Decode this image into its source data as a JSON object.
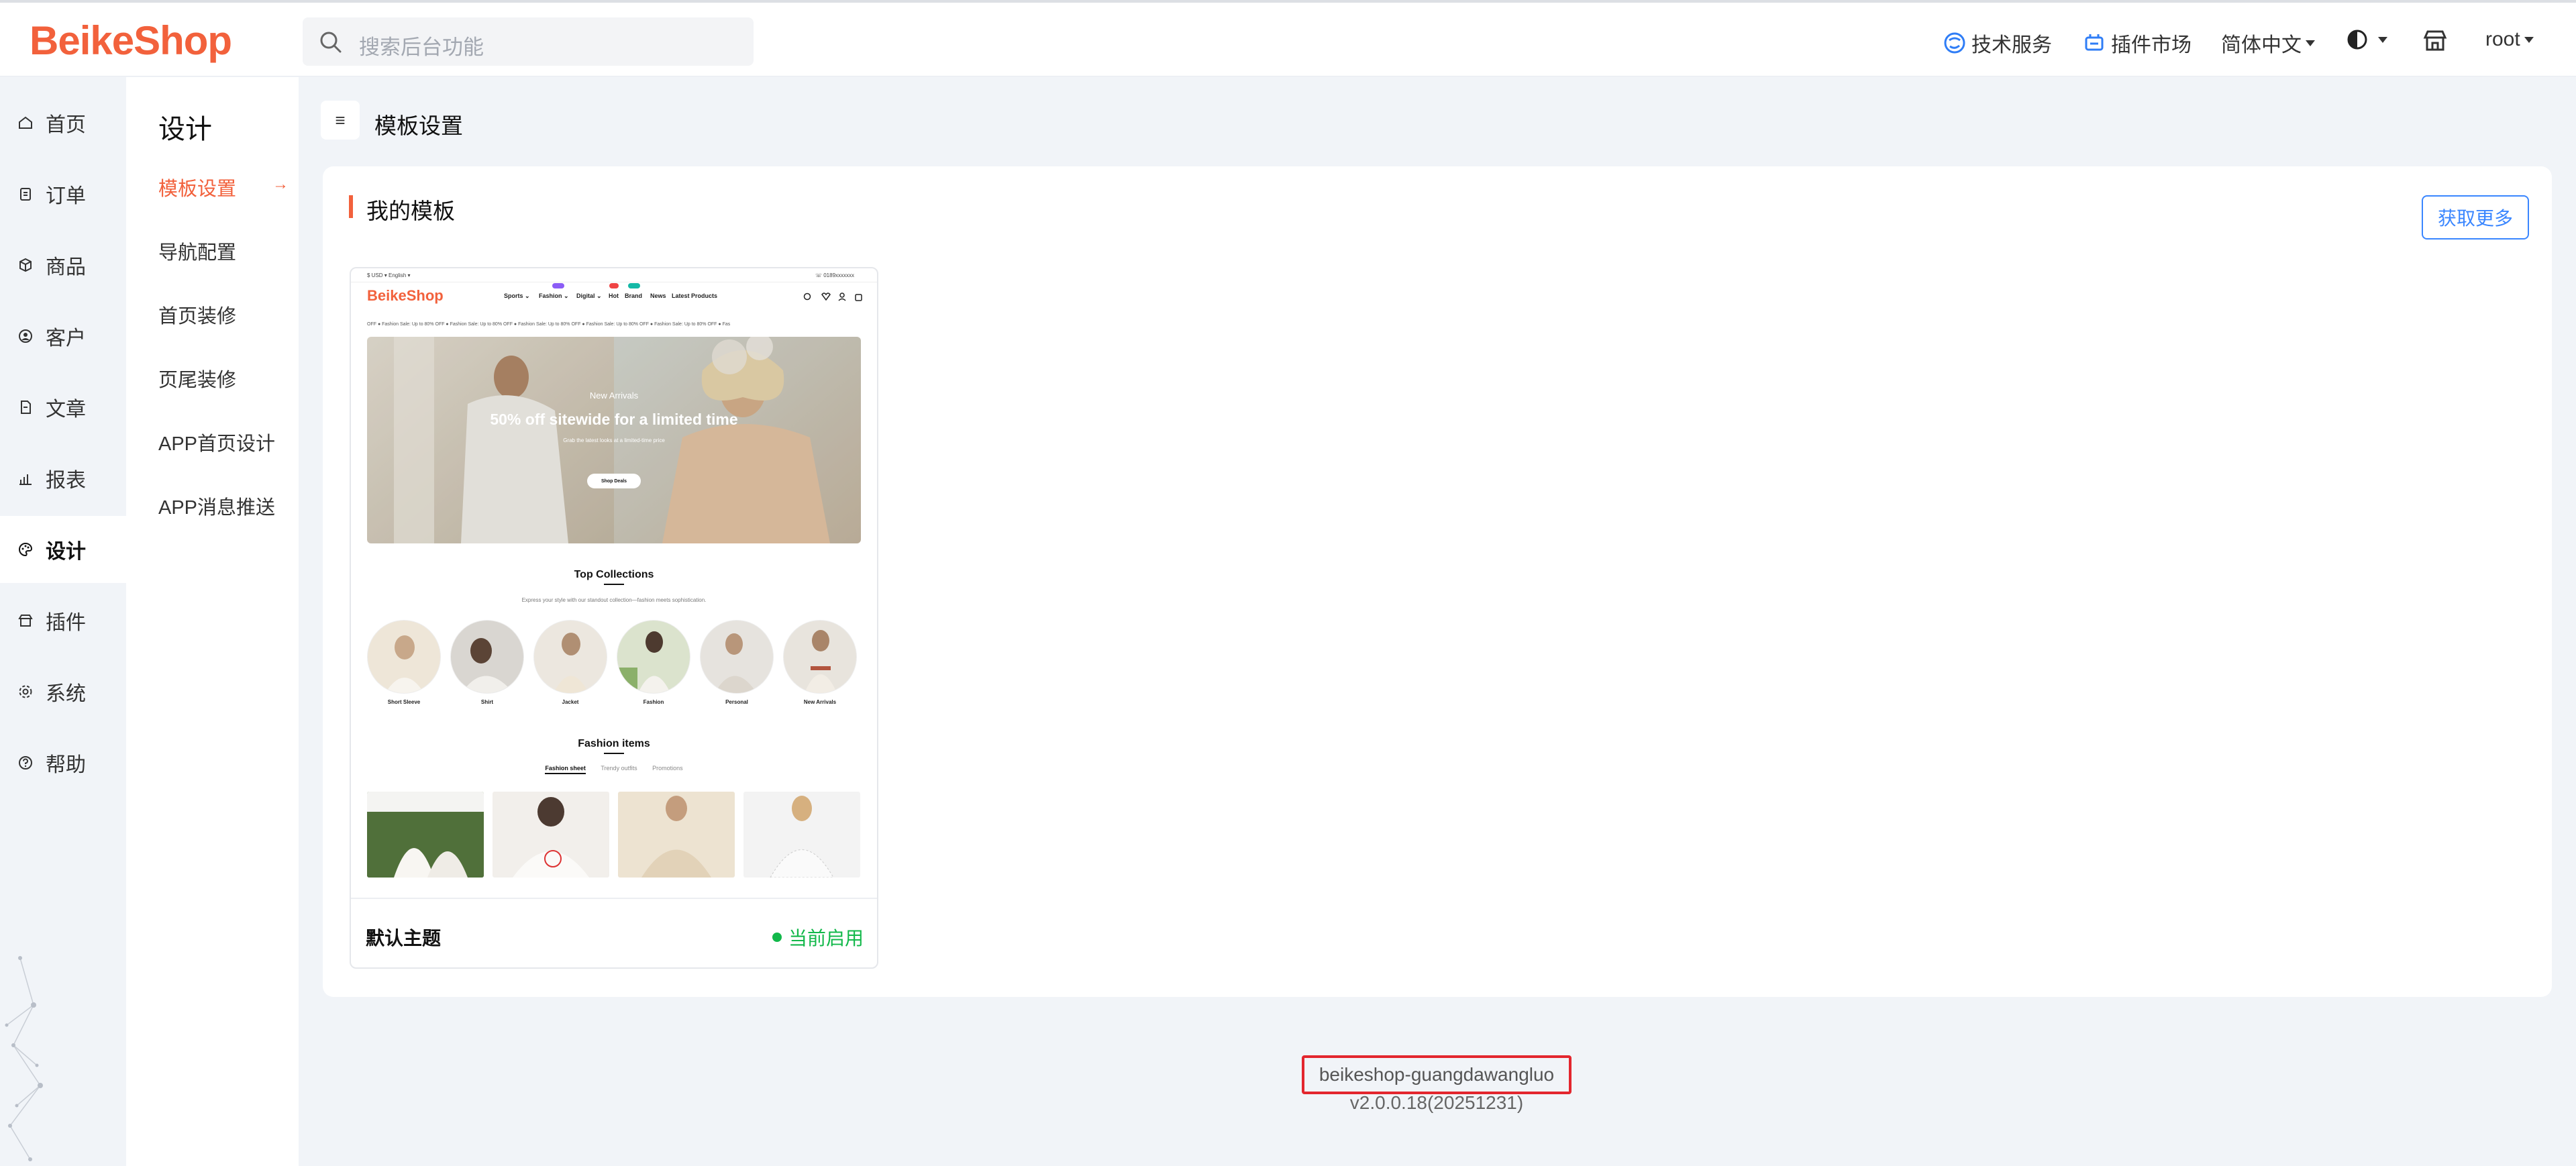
{
  "brand": {
    "logo": "BeikeShop",
    "accent": "#f2613c"
  },
  "search": {
    "placeholder": "搜索后台功能"
  },
  "header_nav": {
    "tech_service": "技术服务",
    "plugin_market": "插件市场",
    "language": "简体中文",
    "user": "root"
  },
  "main_menu": [
    {
      "label": "首页",
      "icon": "home-icon"
    },
    {
      "label": "订单",
      "icon": "clipboard-icon"
    },
    {
      "label": "商品",
      "icon": "box-icon"
    },
    {
      "label": "客户",
      "icon": "user-circle-icon"
    },
    {
      "label": "文章",
      "icon": "file-icon"
    },
    {
      "label": "报表",
      "icon": "bar-chart-icon"
    },
    {
      "label": "设计",
      "icon": "palette-icon",
      "active": true
    },
    {
      "label": "插件",
      "icon": "store-icon"
    },
    {
      "label": "系统",
      "icon": "gear-icon"
    },
    {
      "label": "帮助",
      "icon": "question-icon"
    }
  ],
  "sub_menu": {
    "title": "设计",
    "items": [
      "模板设置",
      "导航配置",
      "首页装修",
      "页尾装修",
      "APP首页设计",
      "APP消息推送"
    ],
    "active_index": 0,
    "arrow": "→"
  },
  "page": {
    "title": "模板设置",
    "toggle_glyph": "≡"
  },
  "card": {
    "title": "我的模板",
    "more_button": "获取更多"
  },
  "template": {
    "name": "默认主题",
    "status": "当前启用",
    "status_color": "#12b84a",
    "preview": {
      "topbar_left": "$ USD ▾     English ▾",
      "topbar_right": "☏ 0189xxxxxxx",
      "logo": "BeikeShop",
      "nav": [
        "Sports ⌄",
        "Fashion ⌄",
        "Digital ⌄",
        "Hot",
        "Brand",
        "News",
        "Latest Products"
      ],
      "marquee": "OFF    ●    Fashion Sale: Up to 80% OFF    ●    Fashion Sale: Up to 80% OFF    ●    Fashion Sale: Up to 80% OFF    ●    Fashion Sale: Up to 80% OFF    ●    Fashion Sale: Up to 80% OFF    ●    Fas",
      "hero_kicker": "New Arrivals",
      "hero_title": "50% off sitewide for a limited time",
      "hero_sub": "Grab the latest looks at a limited-time price",
      "hero_button": "Shop Deals",
      "collections_title": "Top Collections",
      "collections_sub": "Express your style with our standout collection—fashion meets sophistication.",
      "collections": [
        "Short Sleeve",
        "Shirt",
        "Jacket",
        "Fashion",
        "Personal",
        "New Arrivals"
      ],
      "items_title": "Fashion items",
      "tabs": [
        "Fashion sheet",
        "Trendy outfits",
        "Promotions"
      ]
    }
  },
  "footer": {
    "id": "beikeshop-guangdawangluo",
    "version": "v2.0.0.18(20251231)"
  }
}
